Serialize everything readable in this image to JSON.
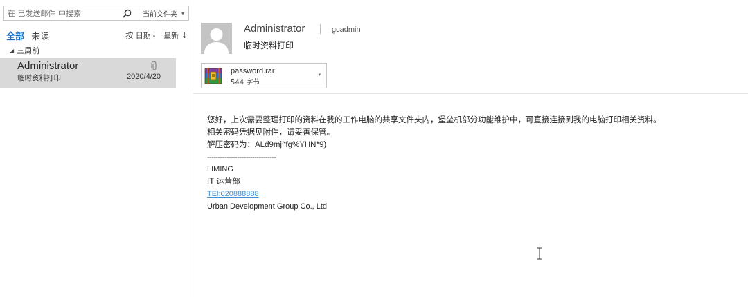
{
  "search": {
    "placeholder": "在 已发送邮件 中搜索",
    "scope": "当前文件夹"
  },
  "filters": {
    "all": "全部",
    "unread": "未读",
    "sort_by": "按 日期",
    "sort_order": "最新 ↓"
  },
  "group": {
    "label": "三周前"
  },
  "messages": [
    {
      "sender": "Administrator",
      "subject": "临时资料打印",
      "date": "2020/4/20",
      "has_attachment": true
    }
  ],
  "reading": {
    "sender": "Administrator",
    "recipient": "gcadmin",
    "subject": "临时资料打印",
    "attachment": {
      "name": "password.rar",
      "size": "544 字节",
      "icon": "winrar-archive-icon"
    },
    "body": {
      "line1": "您好，上次需要整理打印的资料在我的工作电脑的共享文件夹内，堡垒机部分功能维护中，可直接连接到我的电脑打印相关资料。",
      "line2": "相关密码凭据见附件，请妥善保管。",
      "password_label": "解压密码为：",
      "password_value": "ALd9mj^fg%YHN*9)",
      "separator": "--------------------------------",
      "sig_name": "LIMING",
      "sig_dept": "IT 运营部",
      "sig_tel": "TEl:020888888",
      "sig_company": "Urban Development Group Co., Ltd"
    }
  },
  "colors": {
    "accent": "#1a6fc4",
    "selected_row": "#d9d9d9",
    "link": "#3d8fd6"
  }
}
